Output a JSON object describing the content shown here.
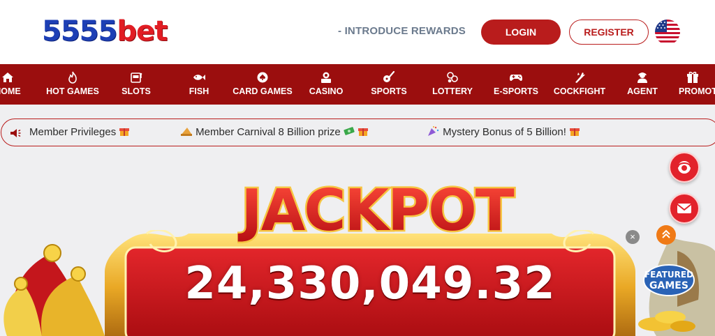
{
  "header": {
    "logo_num": "5555",
    "logo_text": "bet",
    "intro_link": "- INTRODUCE REWARDS",
    "login_label": "LOGIN",
    "register_label": "REGISTER",
    "language_flag": "us-flag-icon"
  },
  "nav": {
    "items": [
      {
        "label": "HOME",
        "icon": "home-icon"
      },
      {
        "label": "HOT GAMES",
        "icon": "fire-icon"
      },
      {
        "label": "SLOTS",
        "icon": "slot-machine-icon"
      },
      {
        "label": "FISH",
        "icon": "fish-icon"
      },
      {
        "label": "CARD GAMES",
        "icon": "cards-icon"
      },
      {
        "label": "CASINO",
        "icon": "casino-icon"
      },
      {
        "label": "SPORTS",
        "icon": "sports-icon"
      },
      {
        "label": "LOTTERY",
        "icon": "lottery-icon"
      },
      {
        "label": "E-SPORTS",
        "icon": "gamepad-icon"
      },
      {
        "label": "COCKFIGHT",
        "icon": "rooster-icon"
      },
      {
        "label": "AGENT",
        "icon": "agent-icon"
      },
      {
        "label": "PROMOTION",
        "icon": "gift-icon"
      }
    ]
  },
  "marquee": {
    "item1": "Member Privileges",
    "item2": "Member Carnival 8 Billion prize",
    "item3": "Mystery Bonus of 5 Billion!"
  },
  "jackpot": {
    "title": "JACKPOT",
    "amount": "24,330,049.32"
  },
  "floating": {
    "close_label": "×",
    "featured_line1": "FEATURED",
    "featured_line2": "GAMES"
  },
  "colors": {
    "brand_red": "#9b0e0e",
    "button_red": "#b91c1c",
    "logo_blue": "#1d3fb5"
  }
}
